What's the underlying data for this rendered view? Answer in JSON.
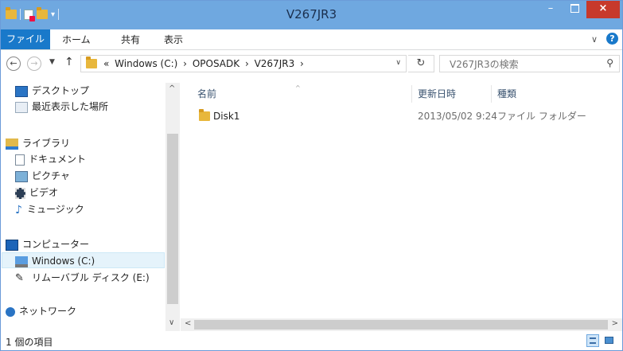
{
  "window": {
    "title": "V267JR3"
  },
  "title_buttons": {
    "minimize": "–",
    "maximize": "",
    "close": "×"
  },
  "ribbon": {
    "file": "ファイル",
    "home": "ホーム",
    "share": "共有",
    "view": "表示",
    "expand": "∨",
    "help": "?"
  },
  "nav": {
    "back": "←",
    "forward": "→",
    "recent": "▼",
    "up": "↑"
  },
  "address": {
    "overflow": "«",
    "crumbs": [
      "Windows (C:)",
      "OPOSADK",
      "V267JR3"
    ],
    "sep": "›",
    "dropdown": "∨",
    "refresh": "↻"
  },
  "search": {
    "placeholder": "V267JR3の検索",
    "icon": "⚲"
  },
  "sidebar": {
    "items": [
      {
        "label": "デスクトップ",
        "icon": "desktop-icon"
      },
      {
        "label": "最近表示した場所",
        "icon": "recent-places-icon"
      },
      {
        "label": "ライブラリ",
        "icon": "libraries-icon"
      },
      {
        "label": "ドキュメント",
        "icon": "documents-icon"
      },
      {
        "label": "ピクチャ",
        "icon": "pictures-icon"
      },
      {
        "label": "ビデオ",
        "icon": "videos-icon"
      },
      {
        "label": "ミュージック",
        "icon": "music-icon"
      },
      {
        "label": "コンピューター",
        "icon": "computer-icon"
      },
      {
        "label": "Windows (C:)",
        "icon": "drive-icon",
        "selected": true
      },
      {
        "label": "リムーバブル ディスク (E:)",
        "icon": "removable-disk-icon"
      },
      {
        "label": "ネットワーク",
        "icon": "network-icon"
      }
    ]
  },
  "columns": {
    "name": "名前",
    "date": "更新日時",
    "type": "種類",
    "sort_indicator": "^"
  },
  "files": [
    {
      "name": "Disk1",
      "date": "2013/05/02 9:24",
      "type": "ファイル フォルダー"
    }
  ],
  "scrollbars": {
    "up": "^",
    "down": "∨",
    "left": "<",
    "right": ">"
  },
  "status": {
    "count": "1 個の項目"
  },
  "colors": {
    "titlebar": "#6fa8e0",
    "file_tab": "#1979ca",
    "close": "#c7392b",
    "selected": "#e5f3fb"
  }
}
